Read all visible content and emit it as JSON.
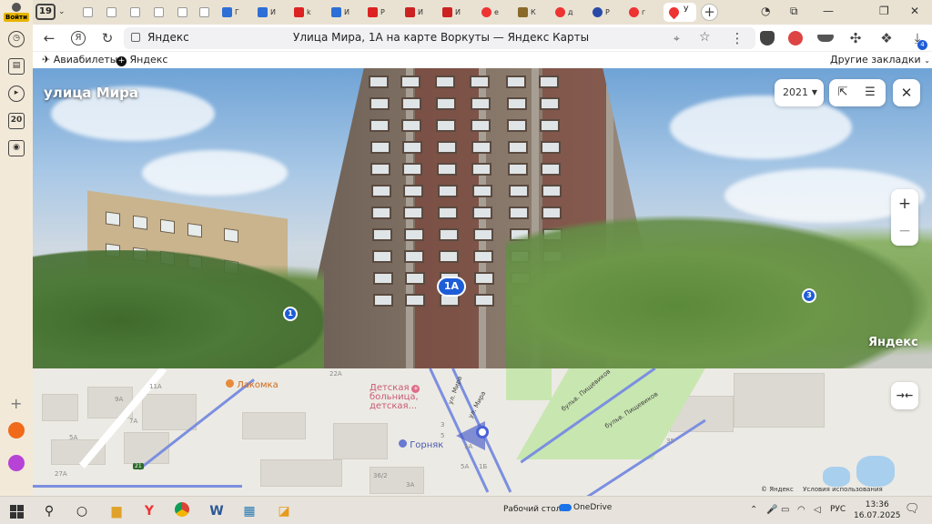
{
  "sidebar": {
    "login_label": "Войти",
    "badge": "20"
  },
  "tabs": {
    "count": "19",
    "items": [
      {
        "title": "Г"
      },
      {
        "title": "И"
      },
      {
        "title": "k"
      },
      {
        "title": "И"
      },
      {
        "title": "Р"
      },
      {
        "title": "И"
      },
      {
        "title": "И"
      },
      {
        "title": "е"
      },
      {
        "title": "К"
      },
      {
        "title": "д"
      },
      {
        "title": "Р"
      },
      {
        "title": "г"
      }
    ],
    "active_title": "У"
  },
  "address_bar": {
    "host": "Яндекс",
    "title": "Улица Мира, 1А на карте Воркуты — Яндекс Карты"
  },
  "extension_badge": "4",
  "bookmarks": {
    "items": [
      {
        "label": "Авиабилеты"
      },
      {
        "label": "Яндекс"
      }
    ],
    "other": "Другие закладки"
  },
  "panorama": {
    "street": "улица Мира",
    "year": "2021",
    "watermark": "Яндекс",
    "markers": {
      "main": "1А",
      "left": "1",
      "right": "3"
    },
    "zoom_in": "+",
    "zoom_out": "−"
  },
  "map": {
    "pois": [
      {
        "label": "Лакомка"
      },
      {
        "label": "Детская"
      },
      {
        "label": "больница,"
      },
      {
        "label": "детская..."
      },
      {
        "label": "Горняк"
      }
    ],
    "streets": [
      "ул. Мира",
      "ул. Мира",
      "бульв. Пищевиков",
      "бульв. Пищевиков"
    ],
    "house_numbers": [
      "22А",
      "11А",
      "9А",
      "7А",
      "5А",
      "27А",
      "3",
      "5",
      "1А",
      "36/2",
      "5А",
      "3А",
      "35",
      "1Б"
    ],
    "road_badge": "21",
    "footer": {
      "brand": "© Яндекс",
      "terms": "Условия использования"
    }
  },
  "taskbar": {
    "desktop": "Рабочий стол",
    "onedrive": "OneDrive",
    "lang": "РУС",
    "time": "13:36",
    "date": "16.07.2025"
  }
}
